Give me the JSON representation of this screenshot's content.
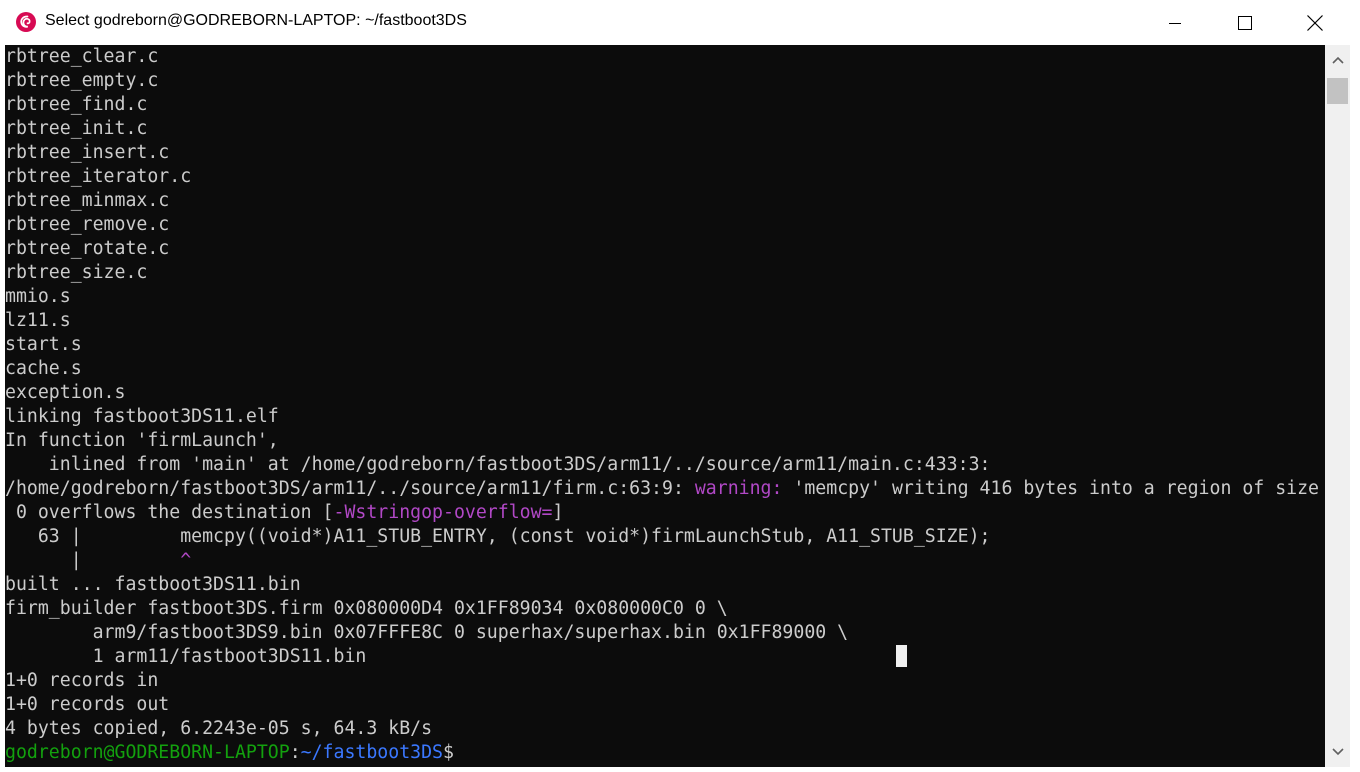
{
  "window": {
    "title": "Select godreborn@GODREBORN-LAPTOP: ~/fastboot3DS",
    "icon": "debian-swirl-icon",
    "controls": {
      "minimize_icon": "minimize-icon",
      "maximize_icon": "maximize-icon",
      "close_icon": "close-icon"
    }
  },
  "terminal": {
    "lines": [
      "rbtree_clear.c",
      "rbtree_empty.c",
      "rbtree_find.c",
      "rbtree_init.c",
      "rbtree_insert.c",
      "rbtree_iterator.c",
      "rbtree_minmax.c",
      "rbtree_remove.c",
      "rbtree_rotate.c",
      "rbtree_size.c",
      "mmio.s",
      "lz11.s",
      "start.s",
      "cache.s",
      "exception.s",
      "linking fastboot3DS11.elf",
      "In function 'firmLaunch',",
      "    inlined from 'main' at /home/godreborn/fastboot3DS/arm11/../source/arm11/main.c:433:3:"
    ],
    "warning_line": {
      "prefix": "/home/godreborn/fastboot3DS/arm11/../source/arm11/firm.c:63:9: ",
      "warning_label": "warning:",
      "message": " 'memcpy' writing 416 bytes into a region of size"
    },
    "overflow_line": {
      "prefix": " 0 overflows the destination [",
      "flag": "-Wstringop-overflow=",
      "suffix": "]"
    },
    "source_line": "   63 |         memcpy((void*)A11_STUB_ENTRY, (const void*)firmLaunchStub, A11_STUB_SIZE);",
    "caret_line": {
      "prefix": "      |         ",
      "caret": "^"
    },
    "lines_after": [
      "built ... fastboot3DS11.bin",
      "firm_builder fastboot3DS.firm 0x080000D4 0x1FF89034 0x080000C0 0 \\",
      "        arm9/fastboot3DS9.bin 0x07FFFE8C 0 superhax/superhax.bin 0x1FF89000 \\",
      "        1 arm11/fastboot3DS11.bin",
      "1+0 records in",
      "1+0 records out",
      "4 bytes copied, 6.2243e-05 s, 64.3 kB/s"
    ],
    "prompt": {
      "user_host": "godreborn@GODREBORN-LAPTOP",
      "separator": ":",
      "path": "~/fastboot3DS",
      "symbol": "$"
    },
    "colors": {
      "background": "#0c0c0c",
      "foreground": "#cccccc",
      "warning": "#b148c6",
      "prompt_user": "#13a10e",
      "prompt_path": "#3b78ff"
    }
  },
  "scrollbar": {
    "up_icon": "scroll-up-arrow-icon",
    "down_icon": "scroll-down-arrow-icon"
  }
}
